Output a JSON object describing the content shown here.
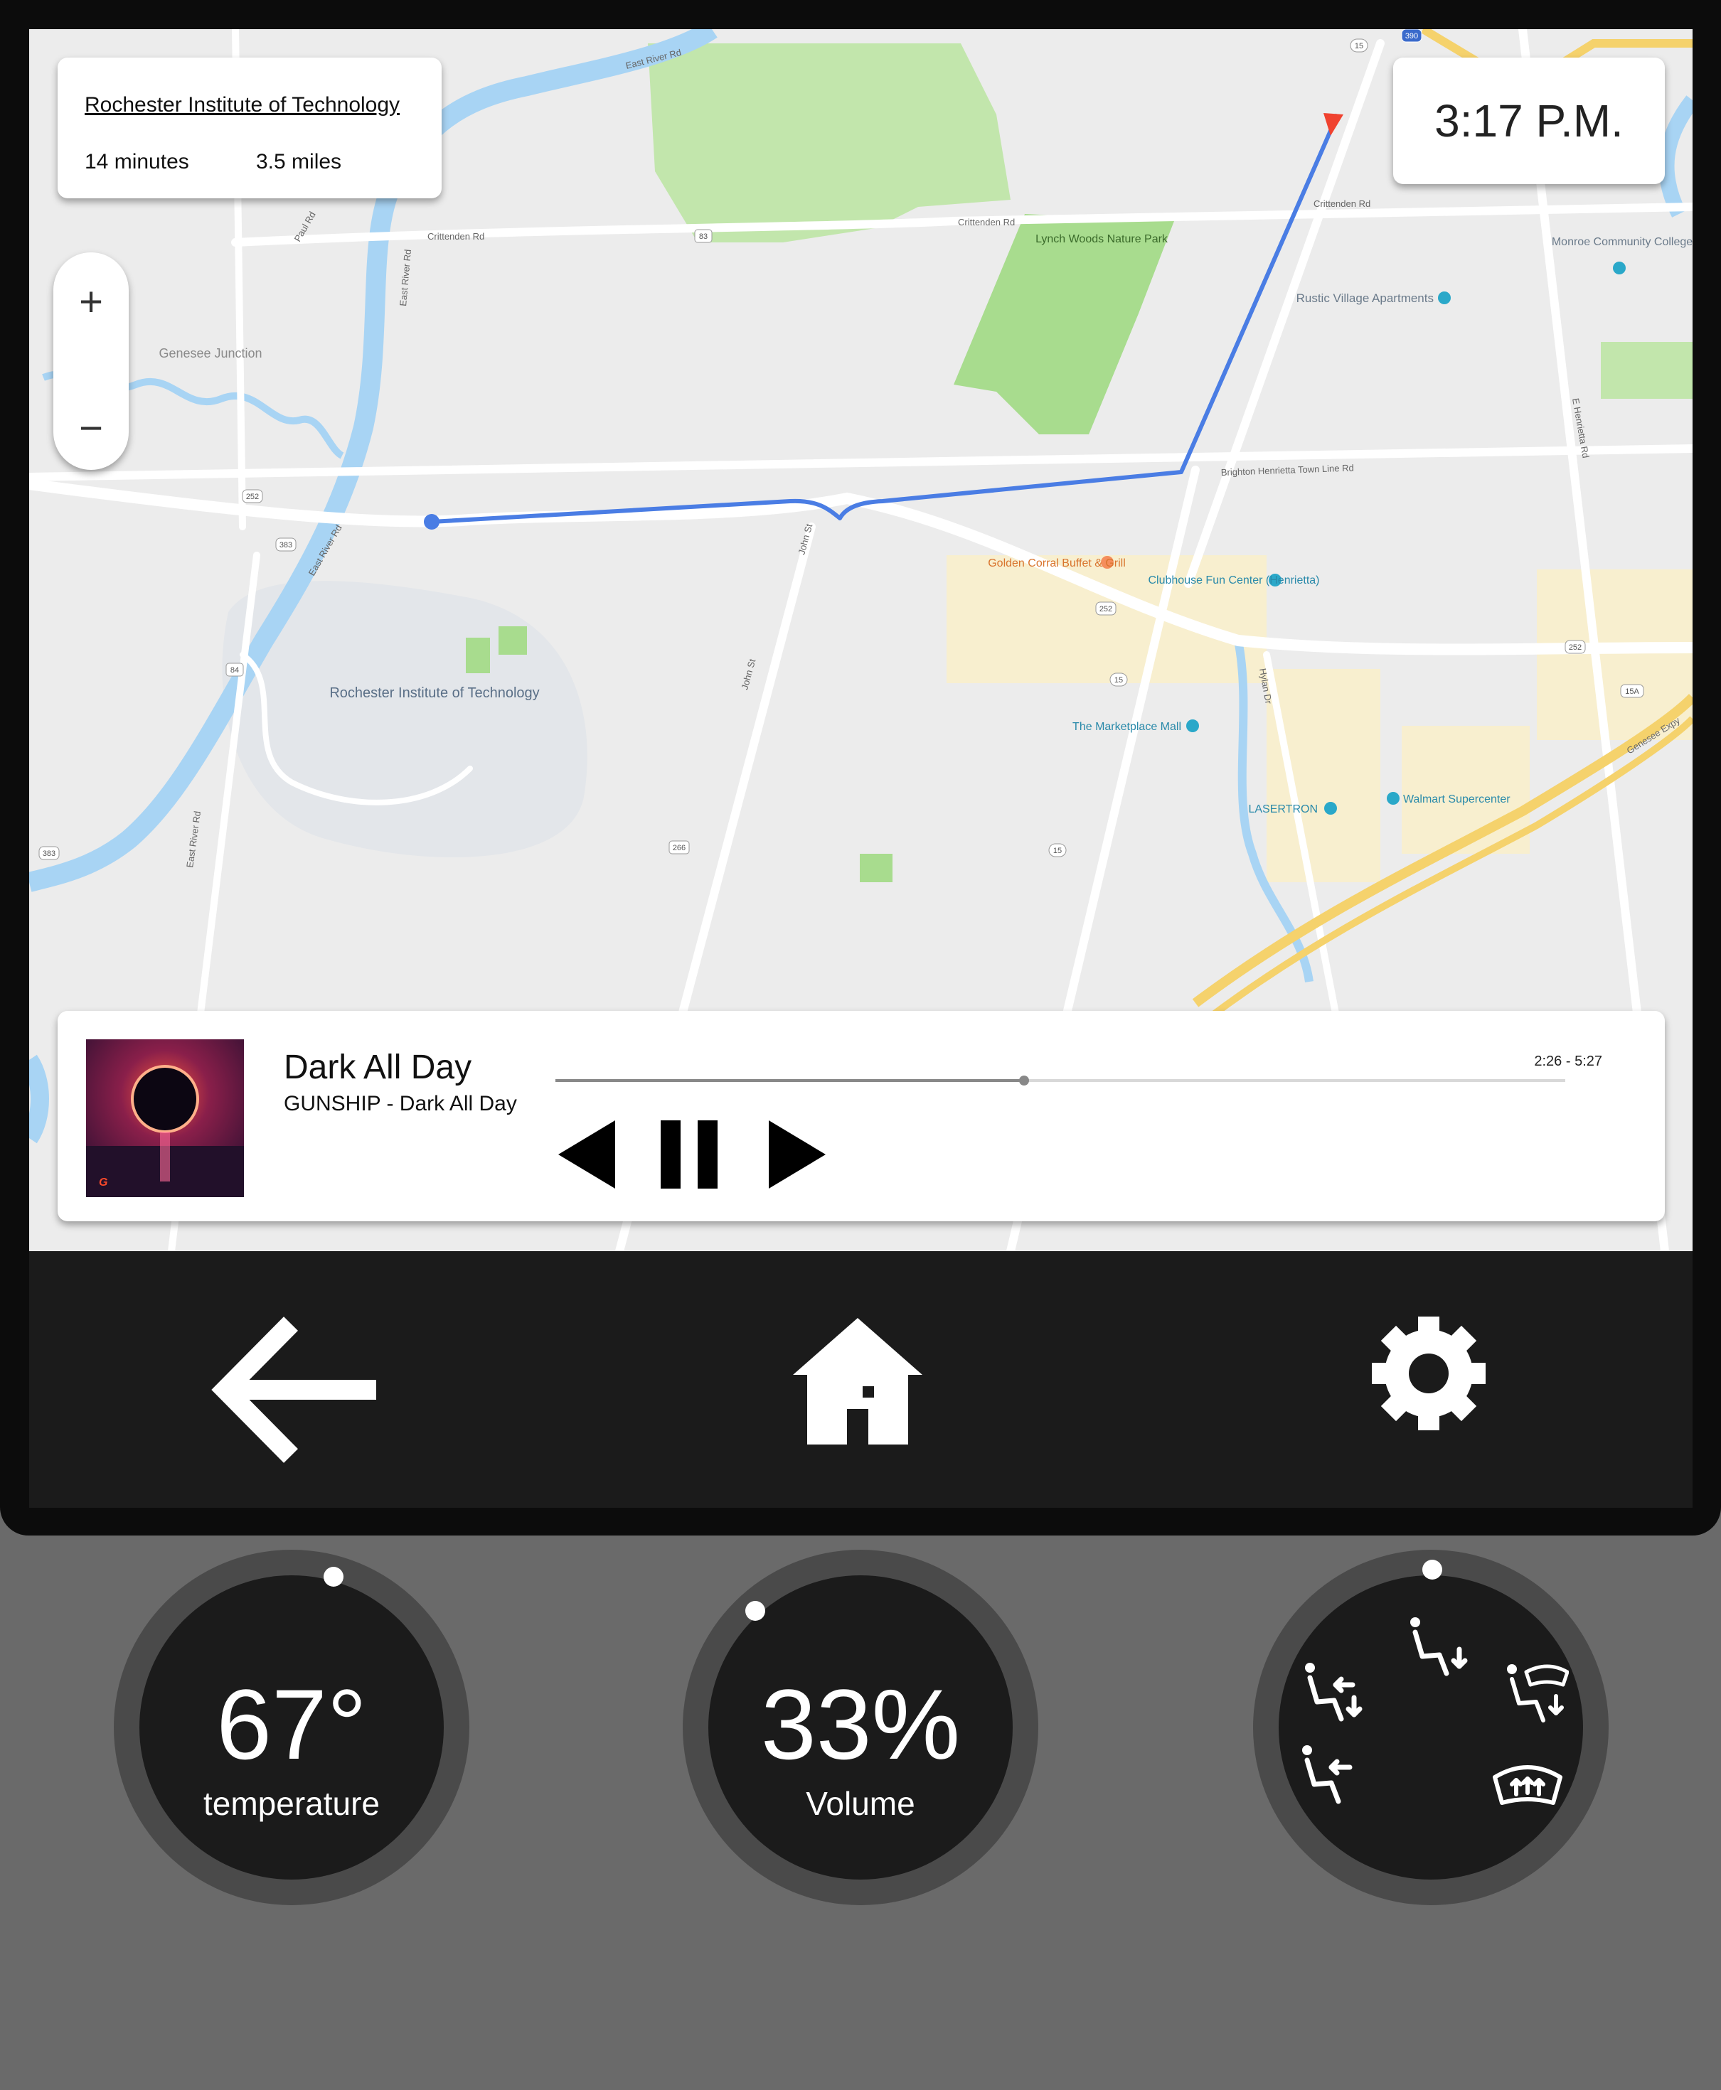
{
  "route": {
    "destination": "Rochester Institute of Technology",
    "duration": "14 minutes",
    "distance": "3.5 miles"
  },
  "clock": {
    "time": "3:17 P.M."
  },
  "zoom": {
    "in_label": "+",
    "out_label": "−"
  },
  "map": {
    "places": {
      "rit": "Rochester Institute of Technology",
      "genesee": "Genesee Junction",
      "lynch": "Lynch Woods Nature Park",
      "monroe": "Monroe Community College",
      "rustic": "Rustic Village Apartments",
      "golden": "Golden Corral Buffet & Grill",
      "clubhouse": "Clubhouse Fun Center (Henrietta)",
      "mall": "The Marketplace Mall",
      "lasertron": "LASERTRON",
      "walmart": "Walmart Supercenter"
    },
    "roads": {
      "east_river": "East River Rd",
      "crittenden": "Crittenden Rd",
      "brighton": "Brighton Henrietta Town Line Rd",
      "john": "John St",
      "hylan": "Hylan Dr",
      "henrietta": "E Henrietta Rd",
      "paul": "Paul Rd",
      "genesee_expy": "Genesee Expy"
    },
    "shields": {
      "s15": "15",
      "s252": "252",
      "s383": "383",
      "s84": "84",
      "s83": "83",
      "s266": "266",
      "s390": "390",
      "s15a": "15A"
    }
  },
  "player": {
    "title": "Dark All Day",
    "artist_album": "GUNSHIP - Dark All Day",
    "time": "2:26 - 5:27",
    "progress": 0.4643
  },
  "climate": {
    "temperature": {
      "value": "67°",
      "label": "temperature"
    },
    "volume": {
      "value": "33%",
      "label": "Volume"
    },
    "airflow_modes": [
      "face",
      "face-and-feet",
      "feet",
      "feet-and-defrost",
      "defrost"
    ]
  },
  "colors": {
    "route": "#4a7de4",
    "destination_flag": "#f0422f",
    "bezel": "#0c0c0c",
    "nav_bar": "#1b1b1b",
    "console": "#6a6a6a"
  },
  "icons": {
    "back": "arrow-left-icon",
    "home": "home-icon",
    "settings": "gear-icon"
  }
}
